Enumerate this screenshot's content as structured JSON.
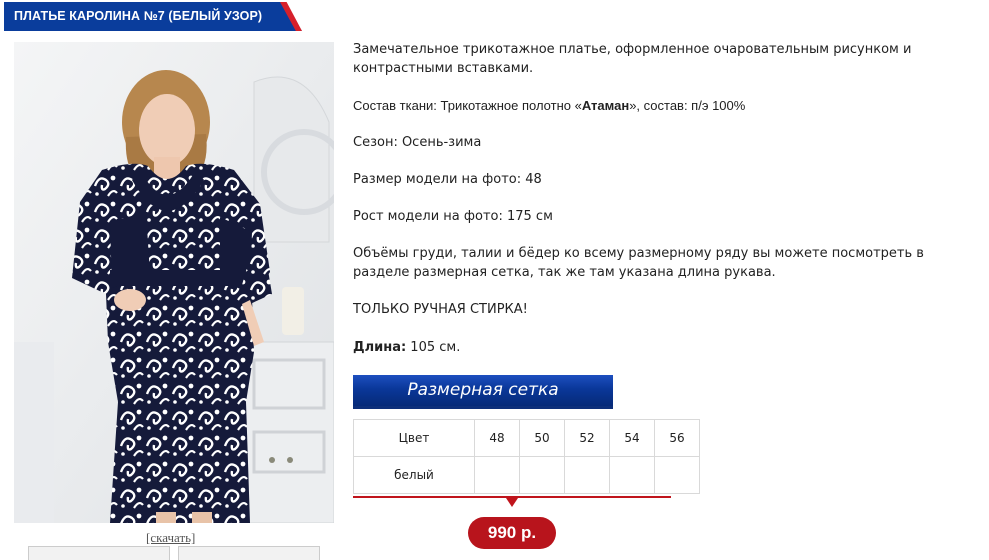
{
  "product": {
    "title": "ПЛАТЬЕ КАРОЛИНА №7 (БЕЛЫЙ УЗОР)",
    "download_label": "[скачать]",
    "description": {
      "intro": "Замечательное трикотажное платье, оформленное очаровательным рисунком и контрастными вставками.",
      "fabric_label": "Состав ткани: ",
      "fabric_pre": "Трикотажное полотно «",
      "fabric_brand": "Атаман",
      "fabric_post": "», состав: п/э 100%",
      "season": "Сезон: Осень-зима",
      "model_size": "Размер модели на фото: 48",
      "model_height": "Рост модели на фото: 175 см",
      "measurements_note": "Объёмы груди, талии и бёдер ко всему размерному ряду вы можете посмотреть в разделе размерная сетка, так же там указана длина рукава.",
      "wash_note": "ТОЛЬКО РУЧНАЯ СТИРКА!",
      "length_label": "Длина:",
      "length_value": " 105 см."
    },
    "size_chart_button": "Размерная сетка",
    "size_table": {
      "header_label": "Цвет",
      "sizes": [
        "48",
        "50",
        "52",
        "54",
        "56"
      ],
      "rows": [
        {
          "color": "белый",
          "cells": [
            "",
            "",
            "",
            "",
            ""
          ]
        }
      ]
    },
    "price": "990 р."
  },
  "colors": {
    "brand_blue": "#0a3d9c",
    "accent_red": "#c0141c",
    "dress_navy": "#151a3a"
  }
}
